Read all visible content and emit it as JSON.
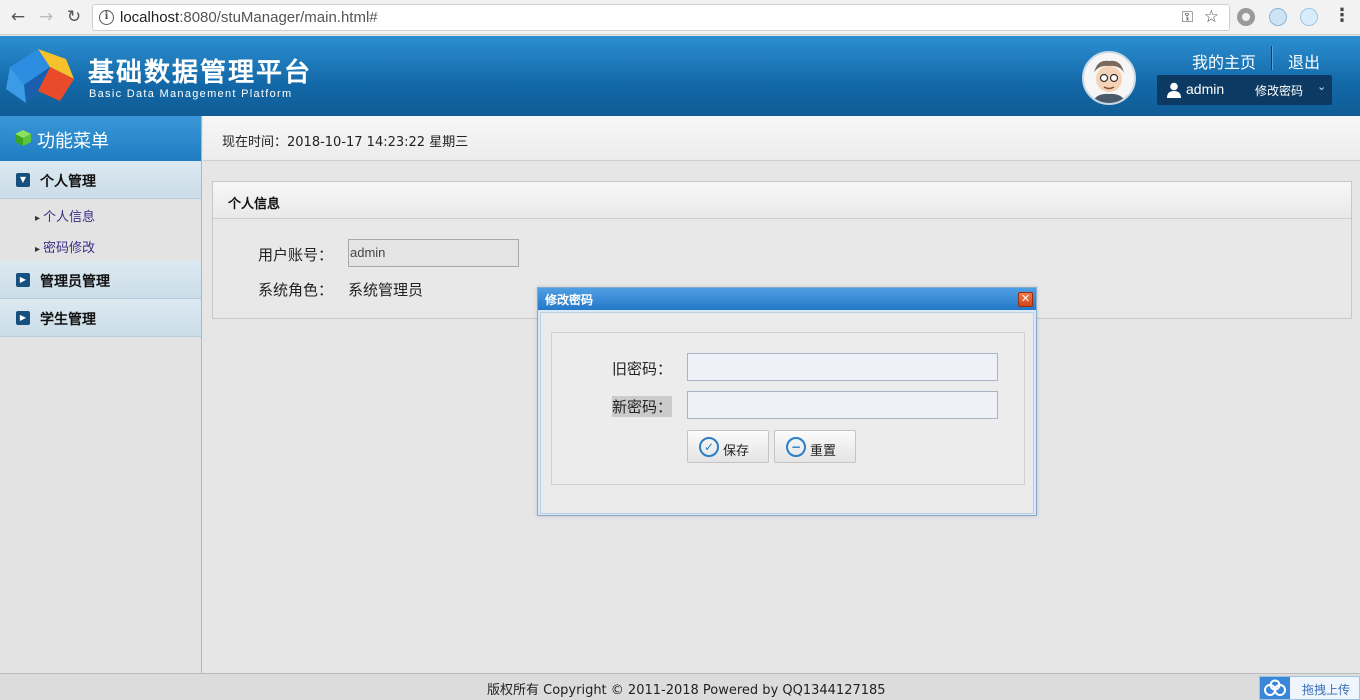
{
  "browser": {
    "url_host": "localhost",
    "url_rest": ":8080/stuManager/main.html#"
  },
  "header": {
    "title": "基础数据管理平台",
    "subtitle": "Basic Data Management Platform",
    "home_link": "我的主页",
    "logout_link": "退出",
    "user_name": "admin",
    "change_password": "修改密码"
  },
  "sidebar": {
    "title": "功能菜单",
    "groups": [
      {
        "label": "个人管理",
        "expanded": true,
        "items": [
          "个人信息",
          "密码修改"
        ]
      },
      {
        "label": "管理员管理",
        "expanded": false
      },
      {
        "label": "学生管理",
        "expanded": false
      }
    ]
  },
  "main": {
    "time_text": "现在时间：2018-10-17 14:23:22 星期三",
    "panel_title": "个人信息",
    "account_label": "用户账号：",
    "account_value": "admin",
    "role_label": "系统角色：",
    "role_value": "系统管理员"
  },
  "dialog": {
    "title": "修改密码",
    "old_label": "旧密码：",
    "new_label": "新密码：",
    "save_label": "保存",
    "reset_label": "重置"
  },
  "footer": {
    "copyright": "版权所有 Copyright © 2011-2018 Powered by QQ1344127185",
    "upload_label": "拖拽上传"
  },
  "colors": {
    "header_blue": "#1368a7",
    "sidebar_head_blue": "#1f7cc2",
    "dialog_title_blue": "#2478c8"
  }
}
